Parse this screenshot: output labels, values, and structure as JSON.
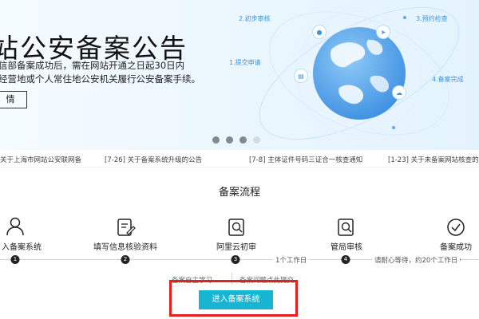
{
  "banner": {
    "title": "站公安备案公告",
    "desc_line1": "信部备案成功后，需在网站开通之日起30日内",
    "desc_line2": "经营地或个人常住地公安机关履行公安备案手续。",
    "detail_button": "情",
    "steps": {
      "s1": "1.提交申请",
      "s2": "2.初步审核",
      "s3": "3.预约检查",
      "s4": "4.备案完成"
    },
    "carousel_count": 4,
    "carousel_active": 4
  },
  "news": [
    "关于上海市网站公安联网备",
    "[7-26] 关于备案系统升级的公告",
    "[7-8] 主体证件号码三证合一核查通知",
    "[1-23] 关于未备案网站核查的公"
  ],
  "process": {
    "title": "备案流程",
    "steps": [
      {
        "label": "入备案系统",
        "num": "1",
        "icon": "user-icon"
      },
      {
        "label": "填写信息核验资料",
        "num": "2",
        "icon": "edit-form-icon"
      },
      {
        "label": "阿里云初审",
        "num": "3",
        "icon": "search-doc-icon"
      },
      {
        "label": "管局审核",
        "num": "4",
        "icon": "review-doc-icon"
      },
      {
        "label": "备案成功",
        "num": "5",
        "icon": "check-circle-icon"
      }
    ],
    "durations": {
      "d3": "1个工作日",
      "d4": "请耐心等待，约20个工作日"
    },
    "help": {
      "left": "备案自主学习",
      "right": "备案问题点此提交"
    },
    "cta": "进入备案系统"
  },
  "colors": {
    "accent": "#18b5d3",
    "highlight": "#e3211f",
    "globe_blue": "#5aa8ee",
    "label_blue": "#3b97e0"
  }
}
